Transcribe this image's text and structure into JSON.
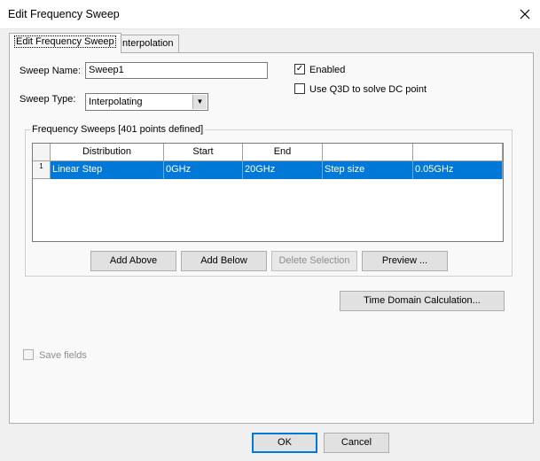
{
  "window": {
    "title": "Edit Frequency Sweep"
  },
  "tabs": [
    {
      "label": "Edit Frequency Sweep",
      "active": true
    },
    {
      "label": "Interpolation",
      "active": false
    }
  ],
  "form": {
    "sweep_name_label": "Sweep Name:",
    "sweep_name_value": "Sweep1",
    "sweep_type_label": "Sweep Type:",
    "sweep_type_value": "Interpolating",
    "enabled_label": "Enabled",
    "enabled_checked": true,
    "use_q3d_label": "Use Q3D to solve DC point",
    "use_q3d_checked": false
  },
  "sweeps": {
    "group_label": "Frequency Sweeps [401 points defined]",
    "columns": [
      "Distribution",
      "Start",
      "End",
      "",
      ""
    ],
    "rows": [
      {
        "index": "1",
        "cells": [
          "Linear Step",
          "0GHz",
          "20GHz",
          "Step size",
          "0.05GHz"
        ],
        "selected": true
      }
    ],
    "buttons": {
      "add_above": "Add Above",
      "add_below": "Add Below",
      "delete_selection": "Delete Selection",
      "preview": "Preview ..."
    }
  },
  "time_domain_button": "Time Domain Calculation...",
  "save_fields_label": "Save fields",
  "save_fields_checked": false,
  "footer": {
    "ok": "OK",
    "cancel": "Cancel"
  },
  "colors": {
    "selection": "#0078d7",
    "dialog_bg": "#f0f0f0",
    "panel_bg": "#f9f9f9"
  }
}
